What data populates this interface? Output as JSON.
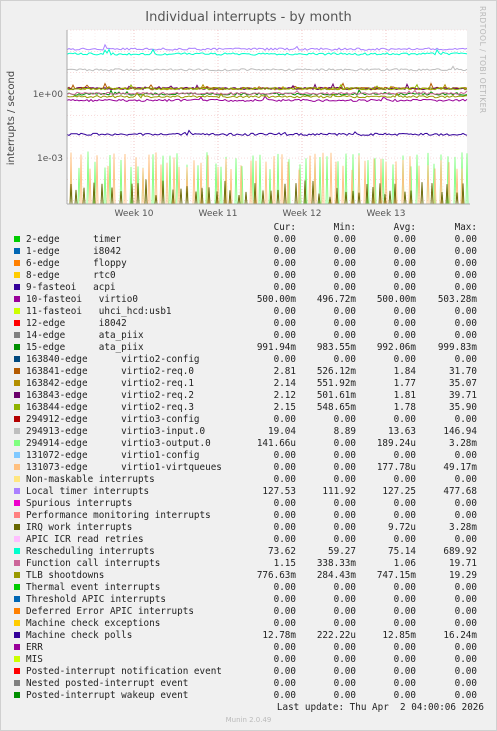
{
  "header": {
    "title": "Individual interrupts - by month",
    "side_label": "RRDTOOL / TOBI OETIKER"
  },
  "chart_data": {
    "type": "line",
    "title": "Individual interrupts - by month",
    "ylabel": "interrupts / second",
    "yscale": "log",
    "y_ticks": [
      {
        "value": 1,
        "label": "1e+00"
      },
      {
        "value": 0.001,
        "label": "1e-03"
      }
    ],
    "ylim": [
      7e-06,
      1000
    ],
    "x_ticks": [
      "Week 10",
      "Week 11",
      "Week 12",
      "Week 13"
    ],
    "grid": true,
    "columns": [
      "Cur:",
      "Min:",
      "Avg:",
      "Max:"
    ],
    "series": [
      {
        "name": "2-edge      timer",
        "color": "#00cc00",
        "cur": "0.00",
        "min": "0.00",
        "avg": "0.00",
        "max": "0.00",
        "level": 0
      },
      {
        "name": "1-edge      i8042",
        "color": "#0066b3",
        "cur": "0.00",
        "min": "0.00",
        "avg": "0.00",
        "max": "0.00",
        "level": 0
      },
      {
        "name": "6-edge      floppy",
        "color": "#ff8000",
        "cur": "0.00",
        "min": "0.00",
        "avg": "0.00",
        "max": "0.00",
        "level": 0
      },
      {
        "name": "8-edge      rtc0",
        "color": "#ffcc00",
        "cur": "0.00",
        "min": "0.00",
        "avg": "0.00",
        "max": "0.00",
        "level": 0
      },
      {
        "name": "9-fasteoi   acpi",
        "color": "#330099",
        "cur": "0.00",
        "min": "0.00",
        "avg": "0.00",
        "max": "0.00",
        "level": 0
      },
      {
        "name": "10-fasteoi   virtio0",
        "color": "#990099",
        "cur": "500.00m",
        "min": "496.72m",
        "avg": "500.00m",
        "max": "503.28m",
        "level": 0.5
      },
      {
        "name": "11-fasteoi   uhci_hcd:usb1",
        "color": "#ccff00",
        "cur": "0.00",
        "min": "0.00",
        "avg": "0.00",
        "max": "0.00",
        "level": 0
      },
      {
        "name": "12-edge      i8042",
        "color": "#ff0000",
        "cur": "0.00",
        "min": "0.00",
        "avg": "0.00",
        "max": "0.00",
        "level": 0
      },
      {
        "name": "14-edge      ata_piix",
        "color": "#808080",
        "cur": "0.00",
        "min": "0.00",
        "avg": "0.00",
        "max": "0.00",
        "level": 0
      },
      {
        "name": "15-edge      ata_piix",
        "color": "#008f00",
        "cur": "991.94m",
        "min": "983.55m",
        "avg": "992.06m",
        "max": "999.83m",
        "level": 0.99
      },
      {
        "name": "163840-edge      virtio2-config",
        "color": "#00487d",
        "cur": "0.00",
        "min": "0.00",
        "avg": "0.00",
        "max": "0.00",
        "level": 0
      },
      {
        "name": "163841-edge      virtio2-req.0",
        "color": "#b35a00",
        "cur": "2.81",
        "min": "526.12m",
        "avg": "1.84",
        "max": "31.70",
        "level": 1.84
      },
      {
        "name": "163842-edge      virtio2-req.1",
        "color": "#b38f00",
        "cur": "2.14",
        "min": "551.92m",
        "avg": "1.77",
        "max": "35.07",
        "level": 1.77
      },
      {
        "name": "163843-edge      virtio2-req.2",
        "color": "#6b006b",
        "cur": "2.12",
        "min": "501.61m",
        "avg": "1.81",
        "max": "39.71",
        "level": 1.81
      },
      {
        "name": "163844-edge      virtio2-req.3",
        "color": "#8fb300",
        "cur": "2.15",
        "min": "548.65m",
        "avg": "1.78",
        "max": "35.90",
        "level": 1.78
      },
      {
        "name": "294912-edge      virtio3-config",
        "color": "#b30000",
        "cur": "0.00",
        "min": "0.00",
        "avg": "0.00",
        "max": "0.00",
        "level": 0
      },
      {
        "name": "294913-edge      virtio3-input.0",
        "color": "#bebebe",
        "cur": "19.04",
        "min": "8.89",
        "avg": "13.63",
        "max": "146.94",
        "level": 13.63
      },
      {
        "name": "294914-edge      virtio3-output.0",
        "color": "#80ff80",
        "cur": "141.66u",
        "min": "0.00",
        "avg": "189.24u",
        "max": "3.28m",
        "level": 0.00019
      },
      {
        "name": "131072-edge      virtio1-config",
        "color": "#80c9ff",
        "cur": "0.00",
        "min": "0.00",
        "avg": "0.00",
        "max": "0.00",
        "level": 0
      },
      {
        "name": "131073-edge      virtio1-virtqueues",
        "color": "#ffc080",
        "cur": "0.00",
        "min": "0.00",
        "avg": "177.78u",
        "max": "49.17m",
        "level": 0.00018
      },
      {
        "name": "Non-maskable interrupts",
        "color": "#ffe680",
        "cur": "0.00",
        "min": "0.00",
        "avg": "0.00",
        "max": "0.00",
        "level": 0
      },
      {
        "name": "Local timer interrupts",
        "color": "#aa80ff",
        "cur": "127.53",
        "min": "111.92",
        "avg": "127.25",
        "max": "477.68",
        "level": 127.25
      },
      {
        "name": "Spurious interrupts",
        "color": "#ee00cc",
        "cur": "0.00",
        "min": "0.00",
        "avg": "0.00",
        "max": "0.00",
        "level": 0
      },
      {
        "name": "Performance monitoring interrupts",
        "color": "#ff8080",
        "cur": "0.00",
        "min": "0.00",
        "avg": "0.00",
        "max": "0.00",
        "level": 0
      },
      {
        "name": "IRQ work interrupts",
        "color": "#666600",
        "cur": "0.00",
        "min": "0.00",
        "avg": "9.72u",
        "max": "3.28m",
        "level": 9.7e-06
      },
      {
        "name": "APIC ICR read retries",
        "color": "#ffbfff",
        "cur": "0.00",
        "min": "0.00",
        "avg": "0.00",
        "max": "0.00",
        "level": 0
      },
      {
        "name": "Rescheduling interrupts",
        "color": "#00ffcc",
        "cur": "73.62",
        "min": "59.27",
        "avg": "75.14",
        "max": "689.92",
        "level": 75.14
      },
      {
        "name": "Function call interrupts",
        "color": "#cc6699",
        "cur": "1.15",
        "min": "338.33m",
        "avg": "1.06",
        "max": "19.71",
        "level": 1.06
      },
      {
        "name": "TLB shootdowns",
        "color": "#999900",
        "cur": "776.63m",
        "min": "284.43m",
        "avg": "747.15m",
        "max": "19.29",
        "level": 0.747
      },
      {
        "name": "Thermal event interrupts",
        "color": "#00cc00",
        "cur": "0.00",
        "min": "0.00",
        "avg": "0.00",
        "max": "0.00",
        "level": 0
      },
      {
        "name": "Threshold APIC interrupts",
        "color": "#0066b3",
        "cur": "0.00",
        "min": "0.00",
        "avg": "0.00",
        "max": "0.00",
        "level": 0
      },
      {
        "name": "Deferred Error APIC interrupts",
        "color": "#ff8000",
        "cur": "0.00",
        "min": "0.00",
        "avg": "0.00",
        "max": "0.00",
        "level": 0
      },
      {
        "name": "Machine check exceptions",
        "color": "#ffcc00",
        "cur": "0.00",
        "min": "0.00",
        "avg": "0.00",
        "max": "0.00",
        "level": 0
      },
      {
        "name": "Machine check polls",
        "color": "#330099",
        "cur": "12.78m",
        "min": "222.22u",
        "avg": "12.85m",
        "max": "16.24m",
        "level": 0.01285
      },
      {
        "name": "ERR",
        "color": "#990099",
        "cur": "0.00",
        "min": "0.00",
        "avg": "0.00",
        "max": "0.00",
        "level": 0
      },
      {
        "name": "MIS",
        "color": "#ccff00",
        "cur": "0.00",
        "min": "0.00",
        "avg": "0.00",
        "max": "0.00",
        "level": 0
      },
      {
        "name": "Posted-interrupt notification event",
        "color": "#ff0000",
        "cur": "0.00",
        "min": "0.00",
        "avg": "0.00",
        "max": "0.00",
        "level": 0
      },
      {
        "name": "Nested posted-interrupt event",
        "color": "#808080",
        "cur": "0.00",
        "min": "0.00",
        "avg": "0.00",
        "max": "0.00",
        "level": 0
      },
      {
        "name": "Posted-interrupt wakeup event",
        "color": "#008f00",
        "cur": "0.00",
        "min": "0.00",
        "avg": "0.00",
        "max": "0.00",
        "level": 0
      }
    ]
  },
  "footer": {
    "last_update": "Last update: Thu Apr  2 04:00:06 2026",
    "version": "Munin 2.0.49"
  }
}
